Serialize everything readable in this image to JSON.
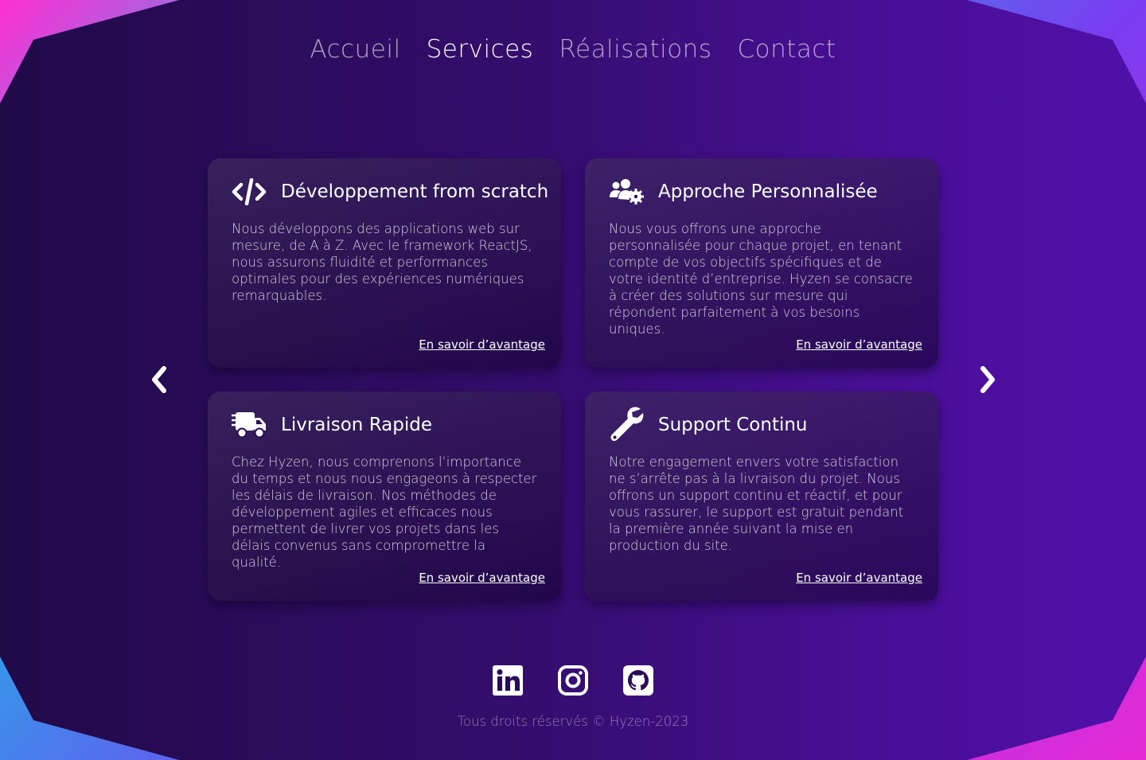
{
  "nav": {
    "items": [
      {
        "label": "Accueil",
        "active": false
      },
      {
        "label": "Services",
        "active": true
      },
      {
        "label": "Réalisations",
        "active": false
      },
      {
        "label": "Contact",
        "active": false
      }
    ]
  },
  "services": [
    {
      "icon": "code-icon",
      "title": "Développement from scratch",
      "text": "Nous développons des applications web sur mesure, de A à Z. Avec le framework ReactJS, nous assurons fluidité et performances optimales pour des expériences numériques remarquables.",
      "link": "En savoir d’avantage"
    },
    {
      "icon": "users-gear-icon",
      "title": "Approche Personnalisée",
      "text": "Nous vous offrons une approche personnalisée pour chaque projet, en tenant compte de vos objectifs spécifiques et de votre identité d’entreprise. Hyzen se consacre à créer des solutions sur mesure qui répondent parfaitement à vos besoins uniques.",
      "link": "En savoir d’avantage"
    },
    {
      "icon": "fast-truck-icon",
      "title": "Livraison Rapide",
      "text": "Chez Hyzen, nous comprenons l’importance du temps et nous nous engageons à respecter les délais de livraison. Nos méthodes de développement agiles et efficaces nous permettent de livrer vos projets dans les délais convenus sans compromettre la qualité.",
      "link": "En savoir d’avantage"
    },
    {
      "icon": "wrench-icon",
      "title": "Support Continu",
      "text": "Notre engagement envers votre satisfaction ne s’arrête pas à la livraison du projet. Nous offrons un support continu et réactif, et pour vous rassurer, le support est gratuit pendant la première année suivant la mise en production du site.",
      "link": "En savoir d’avantage"
    }
  ],
  "carousel": {
    "prev_icon": "chevron-left-icon",
    "next_icon": "chevron-right-icon"
  },
  "socials": [
    "linkedin-icon",
    "instagram-icon",
    "github-icon"
  ],
  "footer": {
    "text": "Tous droits réservés © Hyzen-2023"
  },
  "colors": {
    "background_start": "#200a48",
    "background_end": "#5010a8",
    "text": "#ffffff"
  }
}
